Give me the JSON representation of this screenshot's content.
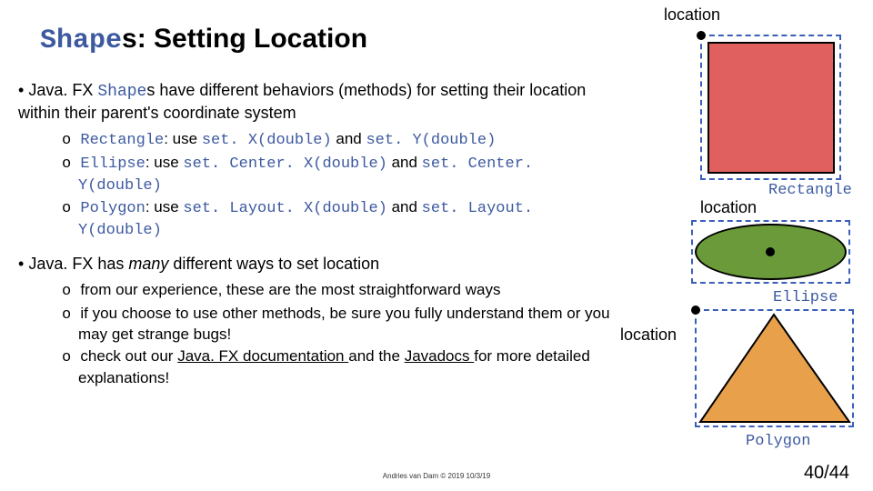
{
  "title": {
    "code_part": "Shape",
    "plain_part": "s: Setting Location"
  },
  "bullets": {
    "b1_pre": "Java. FX ",
    "b1_code": "Shape",
    "b1_post": "s have different behaviors (methods) for setting their location within their parent's coordinate system",
    "s1a_code1": "Rectangle",
    "s1a_txt1": ": use ",
    "s1a_code2": "set. X(double)",
    "s1a_txt2": " and ",
    "s1a_code3": "set. Y(double)",
    "s1b_code1": "Ellipse",
    "s1b_txt1": ": use ",
    "s1b_code2": "set. Center. X(double)",
    "s1b_txt2": " and ",
    "s1b_code3": "set. Center. Y(double)",
    "s1c_code1": "Polygon",
    "s1c_txt1": ": use ",
    "s1c_code2": "set. Layout. X(double)",
    "s1c_txt2": " and ",
    "s1c_code3": "set. Layout. Y(double)",
    "b2_pre": "Java. FX has ",
    "b2_italic": "many",
    "b2_post": " different ways to set location",
    "s2a": "from our experience, these are the most straightforward ways",
    "s2b": "if you choose to use other methods, be sure you fully understand them or you may get strange bugs!",
    "s2c_pre": "check out our ",
    "s2c_link1": "Java. FX documentation ",
    "s2c_mid": "and the ",
    "s2c_link2": "Javadocs ",
    "s2c_post": "for more detailed explanations!"
  },
  "diagram": {
    "loc1": "location",
    "loc2": "location",
    "loc3": "location",
    "rect_label": "Rectangle",
    "ell_label": "Ellipse",
    "poly_label": "Polygon"
  },
  "footer": {
    "credit": "Andries van Dam © 2019 10/3/19",
    "page": "40/44"
  }
}
